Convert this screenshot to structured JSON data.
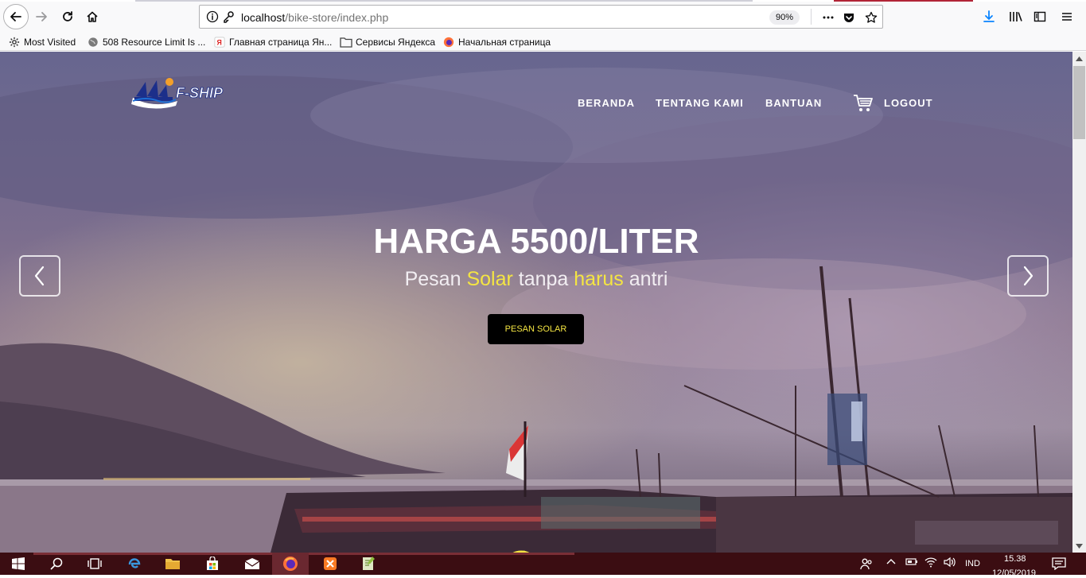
{
  "browser": {
    "url_host": "localhost",
    "url_path": "/bike-store/index.php",
    "zoom": "90%",
    "bookmarks": [
      {
        "label": "Most Visited",
        "icon": "gear-icon"
      },
      {
        "label": "508 Resource Limit Is ...",
        "icon": "globe-icon"
      },
      {
        "label": "Главная страница Ян...",
        "icon": "yandex-icon"
      },
      {
        "label": "Сервисы Яндекса",
        "icon": "folder-icon"
      },
      {
        "label": "Начальная страница",
        "icon": "firefox-icon"
      }
    ]
  },
  "site": {
    "logo_text": "F-SHIP",
    "nav": {
      "home": "BERANDA",
      "about": "TENTANG KAMI",
      "help": "BANTUAN",
      "logout": "LOGOUT"
    },
    "hero": {
      "title": "HARGA 5500/LITER",
      "subtitle_parts": [
        "Pesan ",
        "Solar",
        " tanpa ",
        "harus",
        " antri"
      ],
      "cta": "PESAN SOLAR"
    },
    "colors": {
      "accent_yellow": "#f4e542",
      "cta_bg": "#000000",
      "taskbar": "#3b0d12"
    }
  },
  "taskbar": {
    "language": "IND",
    "time": "15.38",
    "date": "12/05/2019"
  }
}
